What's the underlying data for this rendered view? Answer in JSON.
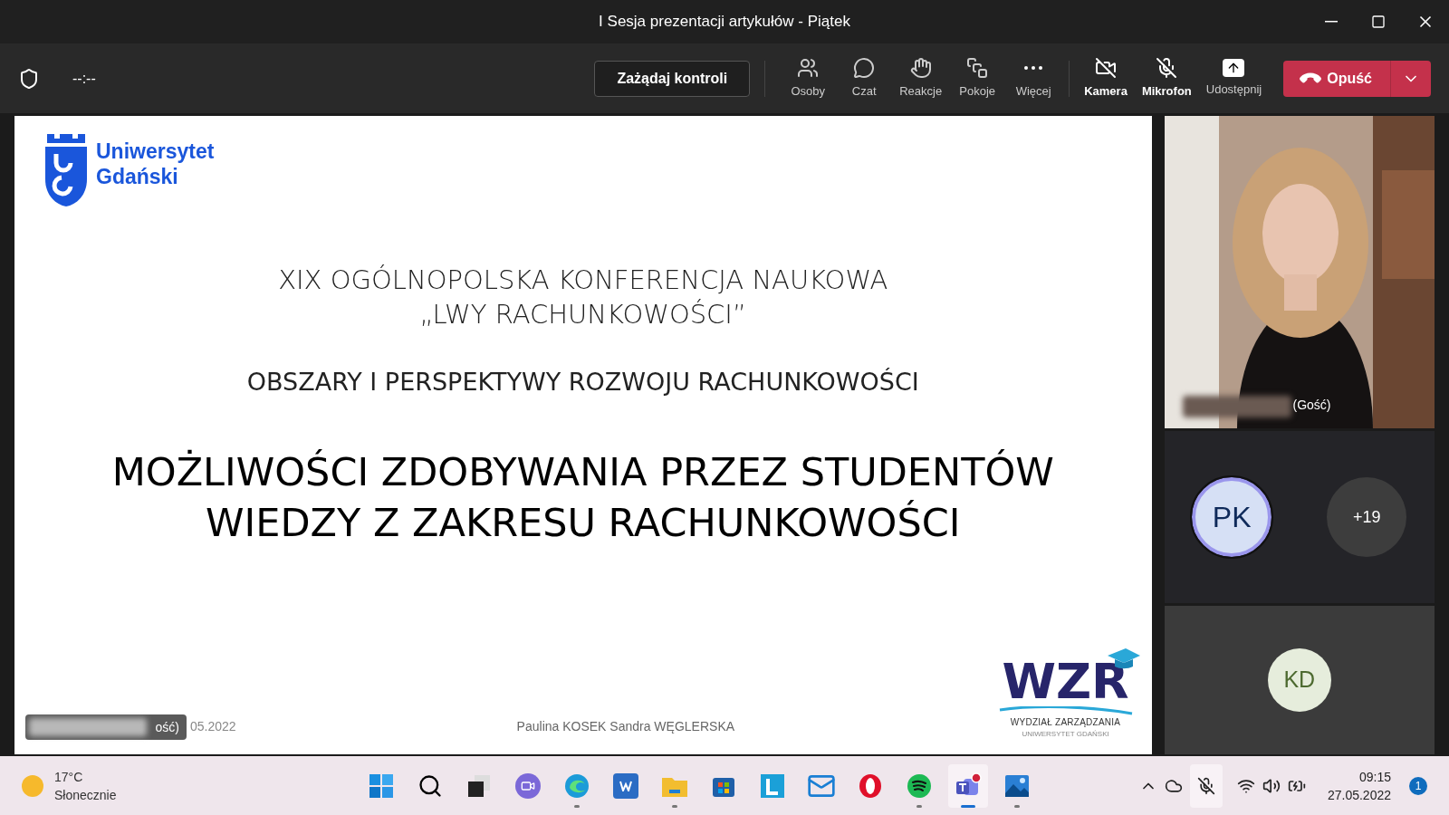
{
  "window": {
    "title": "I Sesja prezentacji artykułów - Piątek"
  },
  "toolbar": {
    "timer": "--:--",
    "request_control": "Zażądaj kontroli",
    "items": [
      {
        "kind": "people",
        "label": "Osoby"
      },
      {
        "kind": "chat",
        "label": "Czat"
      },
      {
        "kind": "reactions",
        "label": "Reakcje"
      },
      {
        "kind": "rooms",
        "label": "Pokoje"
      },
      {
        "kind": "more",
        "label": "Więcej"
      },
      {
        "kind": "camera",
        "label": "Kamera",
        "on": false
      },
      {
        "kind": "mic",
        "label": "Mikrofon",
        "on": false
      },
      {
        "kind": "share",
        "label": "Udostępnij"
      }
    ],
    "leave": "Opuść"
  },
  "slide": {
    "logo": [
      "Uniwersytet",
      "Gdański"
    ],
    "conference": [
      "XIX OGÓLNOPOLSKA KONFERENCJA NAUKOWA",
      "„LWY RACHUNKOWOŚCI”"
    ],
    "subtitle": "OBSZARY I PERSPEKTYWY ROZWOJU RACHUNKOWOŚCI",
    "title": [
      "MOŻLIWOŚCI ZDOBYWANIA PRZEZ STUDENTÓW",
      "WIEDZY Z ZAKRESU RACHUNKOWOŚCI"
    ],
    "date": "05.2022",
    "authors": "Paulina KOSEK Sandra WĘGLERSKA",
    "faculty_logo": {
      "mark": "WZR",
      "name": "WYDZIAŁ ZARZĄDZANIA",
      "university": "UNIWERSYTET GDAŃSKI"
    },
    "presenter_tag": "ość)"
  },
  "participants": {
    "video_tag": "(Gość)",
    "avatars": [
      {
        "initials": "PK",
        "color": "#d6e0f5",
        "speaking": true
      },
      {
        "initials": "+19",
        "color": "#3d3d3d",
        "speaking": false
      }
    ],
    "tile": {
      "initials": "KD",
      "color": "#e6eddc"
    }
  },
  "taskbar": {
    "weather": {
      "temp": "17°C",
      "text": "Słonecznie"
    },
    "apps": [
      {
        "kind": "start",
        "running": false,
        "active": false
      },
      {
        "kind": "search",
        "running": false,
        "active": false
      },
      {
        "kind": "taskview",
        "running": false,
        "active": false
      },
      {
        "kind": "chat",
        "running": false,
        "active": false
      },
      {
        "kind": "edge",
        "running": true,
        "active": false
      },
      {
        "kind": "word",
        "running": false,
        "active": false
      },
      {
        "kind": "files",
        "running": true,
        "active": false
      },
      {
        "kind": "store",
        "running": false,
        "active": false
      },
      {
        "kind": "l",
        "running": false,
        "active": false
      },
      {
        "kind": "mail",
        "running": false,
        "active": false
      },
      {
        "kind": "opera",
        "running": false,
        "active": false
      },
      {
        "kind": "spotify",
        "running": true,
        "active": false
      },
      {
        "kind": "teams",
        "running": true,
        "active": true
      },
      {
        "kind": "photos",
        "running": true,
        "active": false
      }
    ],
    "time": "09:15",
    "date": "27.05.2022",
    "notifications": "1"
  }
}
